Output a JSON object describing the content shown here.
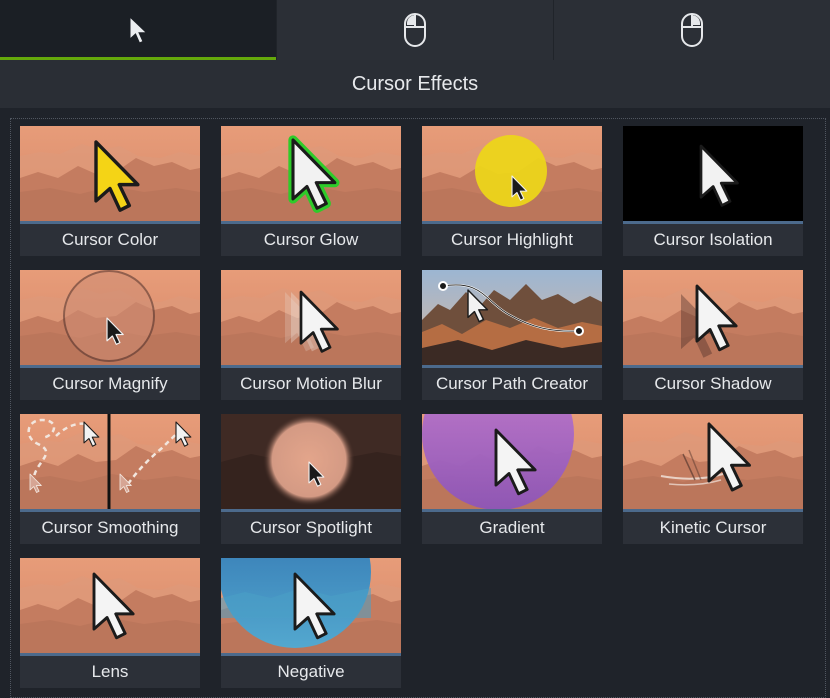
{
  "tabs": [
    {
      "icon": "cursor-arrow-icon",
      "active": true
    },
    {
      "icon": "mouse-left-click-icon",
      "active": false
    },
    {
      "icon": "mouse-right-click-icon",
      "active": false
    }
  ],
  "header": {
    "title": "Cursor Effects"
  },
  "colors": {
    "accent": "#64a80b",
    "panel": "#1f232a",
    "tile": "#2c3038",
    "thumb_bar": "#4c6a8c"
  },
  "effects": [
    {
      "label": "Cursor Color",
      "thumb": "color"
    },
    {
      "label": "Cursor Glow",
      "thumb": "glow"
    },
    {
      "label": "Cursor Highlight",
      "thumb": "highlight"
    },
    {
      "label": "Cursor Isolation",
      "thumb": "isolation"
    },
    {
      "label": "Cursor Magnify",
      "thumb": "magnify"
    },
    {
      "label": "Cursor Motion Blur",
      "thumb": "motionblur"
    },
    {
      "label": "Cursor Path Creator",
      "thumb": "path"
    },
    {
      "label": "Cursor Shadow",
      "thumb": "shadow"
    },
    {
      "label": "Cursor Smoothing",
      "thumb": "smoothing"
    },
    {
      "label": "Cursor Spotlight",
      "thumb": "spotlight"
    },
    {
      "label": "Gradient",
      "thumb": "gradient"
    },
    {
      "label": "Kinetic Cursor",
      "thumb": "kinetic"
    },
    {
      "label": "Lens",
      "thumb": "lens"
    },
    {
      "label": "Negative",
      "thumb": "negative"
    }
  ]
}
